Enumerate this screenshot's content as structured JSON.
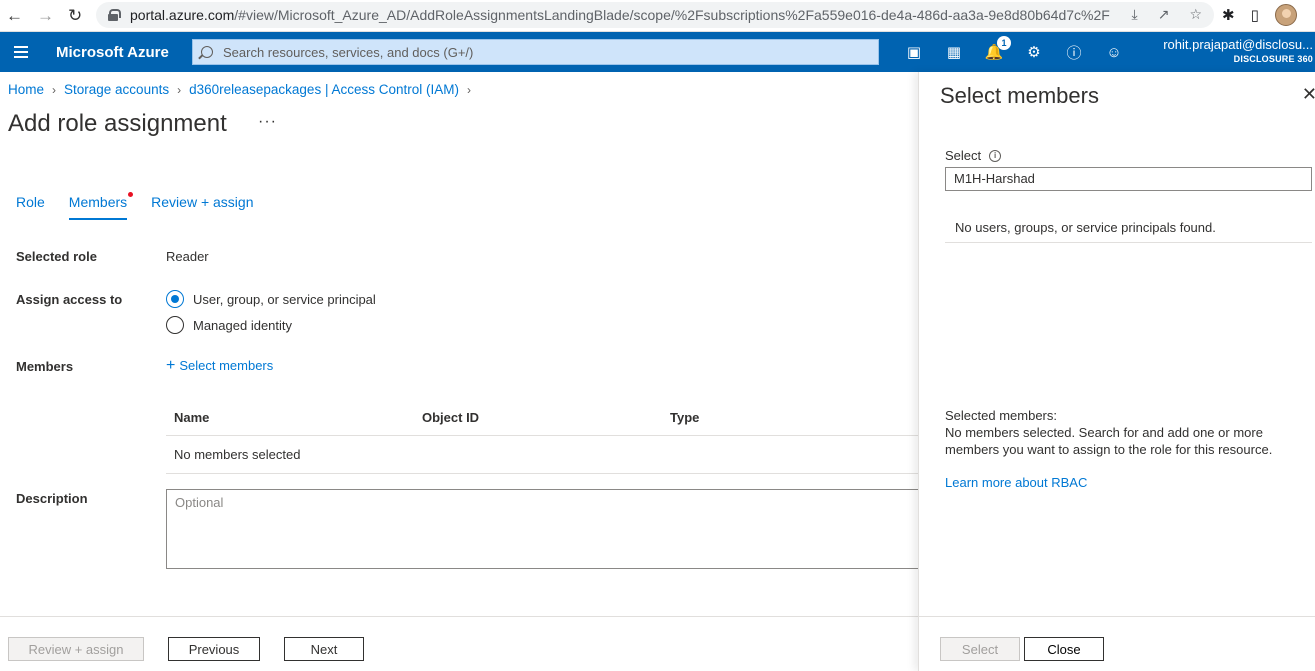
{
  "browser": {
    "url_domain": "portal.azure.com",
    "url_path": "/#view/Microsoft_Azure_AD/AddRoleAssignmentsLandingBlade/scope/%2Fsubscriptions%2Fa559e016-de4a-486d-aa3a-9e8d80b64d7c%2Fr..."
  },
  "azure": {
    "brand": "Microsoft Azure",
    "search_placeholder": "Search resources, services, and docs (G+/)",
    "notification_count": "1",
    "account_email": "rohit.prajapati@disclosu...",
    "account_org": "DISCLOSURE 360"
  },
  "breadcrumb": [
    "Home",
    "Storage accounts",
    "d360releasepackages | Access Control (IAM)"
  ],
  "page": {
    "title": "Add role assignment",
    "more": "···"
  },
  "tabs": [
    {
      "label": "Role"
    },
    {
      "label": "Members"
    },
    {
      "label": "Review + assign"
    }
  ],
  "form": {
    "selected_role_label": "Selected role",
    "selected_role_value": "Reader",
    "assign_access_label": "Assign access to",
    "option_user": "User, group, or service principal",
    "option_managed": "Managed identity",
    "members_label": "Members",
    "select_members_link": "Select members",
    "description_label": "Description",
    "description_placeholder": "Optional"
  },
  "members_table": {
    "headers": [
      "Name",
      "Object ID",
      "Type"
    ],
    "empty": "No members selected"
  },
  "footer": {
    "review_assign": "Review + assign",
    "previous": "Previous",
    "next": "Next"
  },
  "panel": {
    "title": "Select members",
    "select_label": "Select",
    "search_value": "M1H-Harshad",
    "no_results": "No users, groups, or service principals found.",
    "selected_heading": "Selected members:",
    "selected_text": "No members selected. Search for and add one or more members you want to assign to the role for this resource.",
    "learn_more": "Learn more about RBAC",
    "select_button": "Select",
    "close_button": "Close"
  }
}
